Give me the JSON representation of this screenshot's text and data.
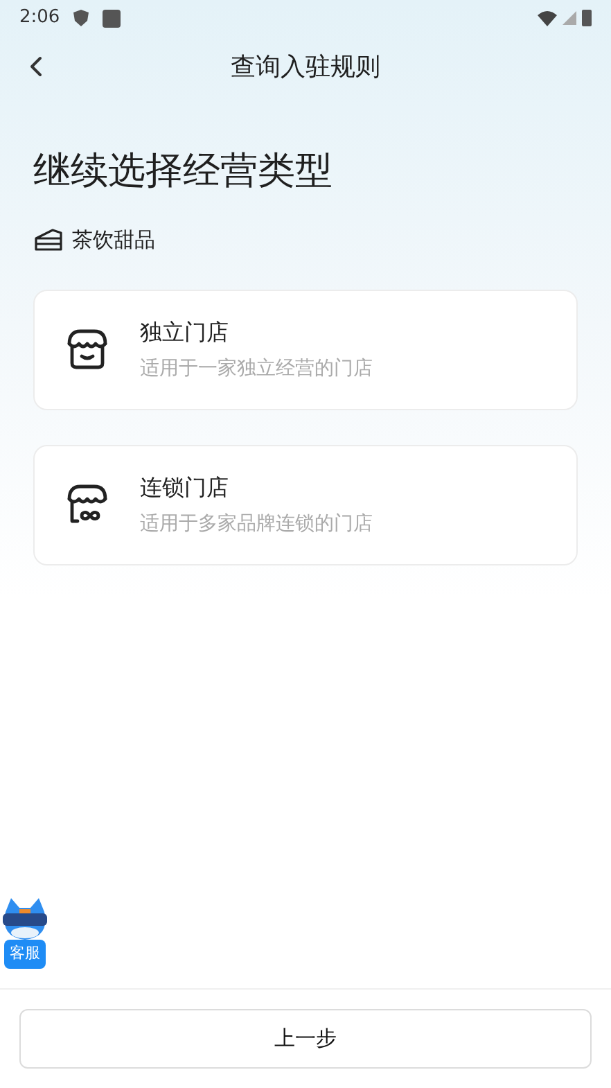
{
  "status_bar": {
    "time": "2:06"
  },
  "header": {
    "title": "查询入驻规则"
  },
  "heading": "继续选择经营类型",
  "category": {
    "label": "茶饮甜品"
  },
  "options": [
    {
      "kind": "single",
      "title": "独立门店",
      "description": "适用于一家独立经营的门店"
    },
    {
      "kind": "chain",
      "title": "连锁门店",
      "description": "适用于多家品牌连锁的门店"
    }
  ],
  "support": {
    "label": "客服"
  },
  "footer": {
    "button": "上一步"
  }
}
